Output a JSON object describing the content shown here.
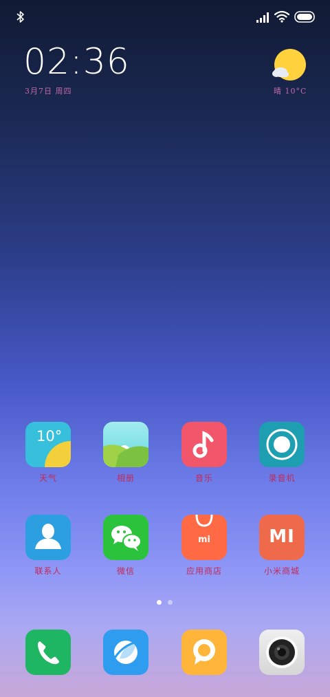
{
  "status_bar": {
    "icons": [
      "bluetooth-icon",
      "cellular-signal-icon",
      "wifi-icon",
      "battery-icon"
    ]
  },
  "clock": {
    "time": "02:36",
    "date": "3月7日 周四"
  },
  "weather": {
    "text": "晴 10°C",
    "icon": "partly-sunny-icon"
  },
  "home": {
    "apps": [
      {
        "name": "weather",
        "label": "天气",
        "icon_text": "10°"
      },
      {
        "name": "gallery",
        "label": "相册"
      },
      {
        "name": "music",
        "label": "音乐"
      },
      {
        "name": "recorder",
        "label": "录音机"
      },
      {
        "name": "contacts",
        "label": "联系人"
      },
      {
        "name": "wechat",
        "label": "微信"
      },
      {
        "name": "app-store",
        "label": "应用商店",
        "icon_text": "mi"
      },
      {
        "name": "mi-store",
        "label": "小米商城",
        "icon_text": "MI"
      }
    ],
    "page_indicator": {
      "current": 1,
      "total": 2
    }
  },
  "dock": {
    "apps": [
      {
        "name": "phone"
      },
      {
        "name": "browser"
      },
      {
        "name": "messages"
      },
      {
        "name": "camera"
      }
    ]
  },
  "colors": {
    "label_text": "#c12a59",
    "weather_app": "#36c0dc",
    "music": "#f2566b",
    "recorder": "#1e9fb1",
    "contacts": "#2b9fe0",
    "wechat": "#2cc33c",
    "app_store": "#ff6a45",
    "mi_store": "#ef6a4b",
    "phone": "#1fb663",
    "browser": "#2e9df0",
    "messages": "#ffb53a"
  }
}
